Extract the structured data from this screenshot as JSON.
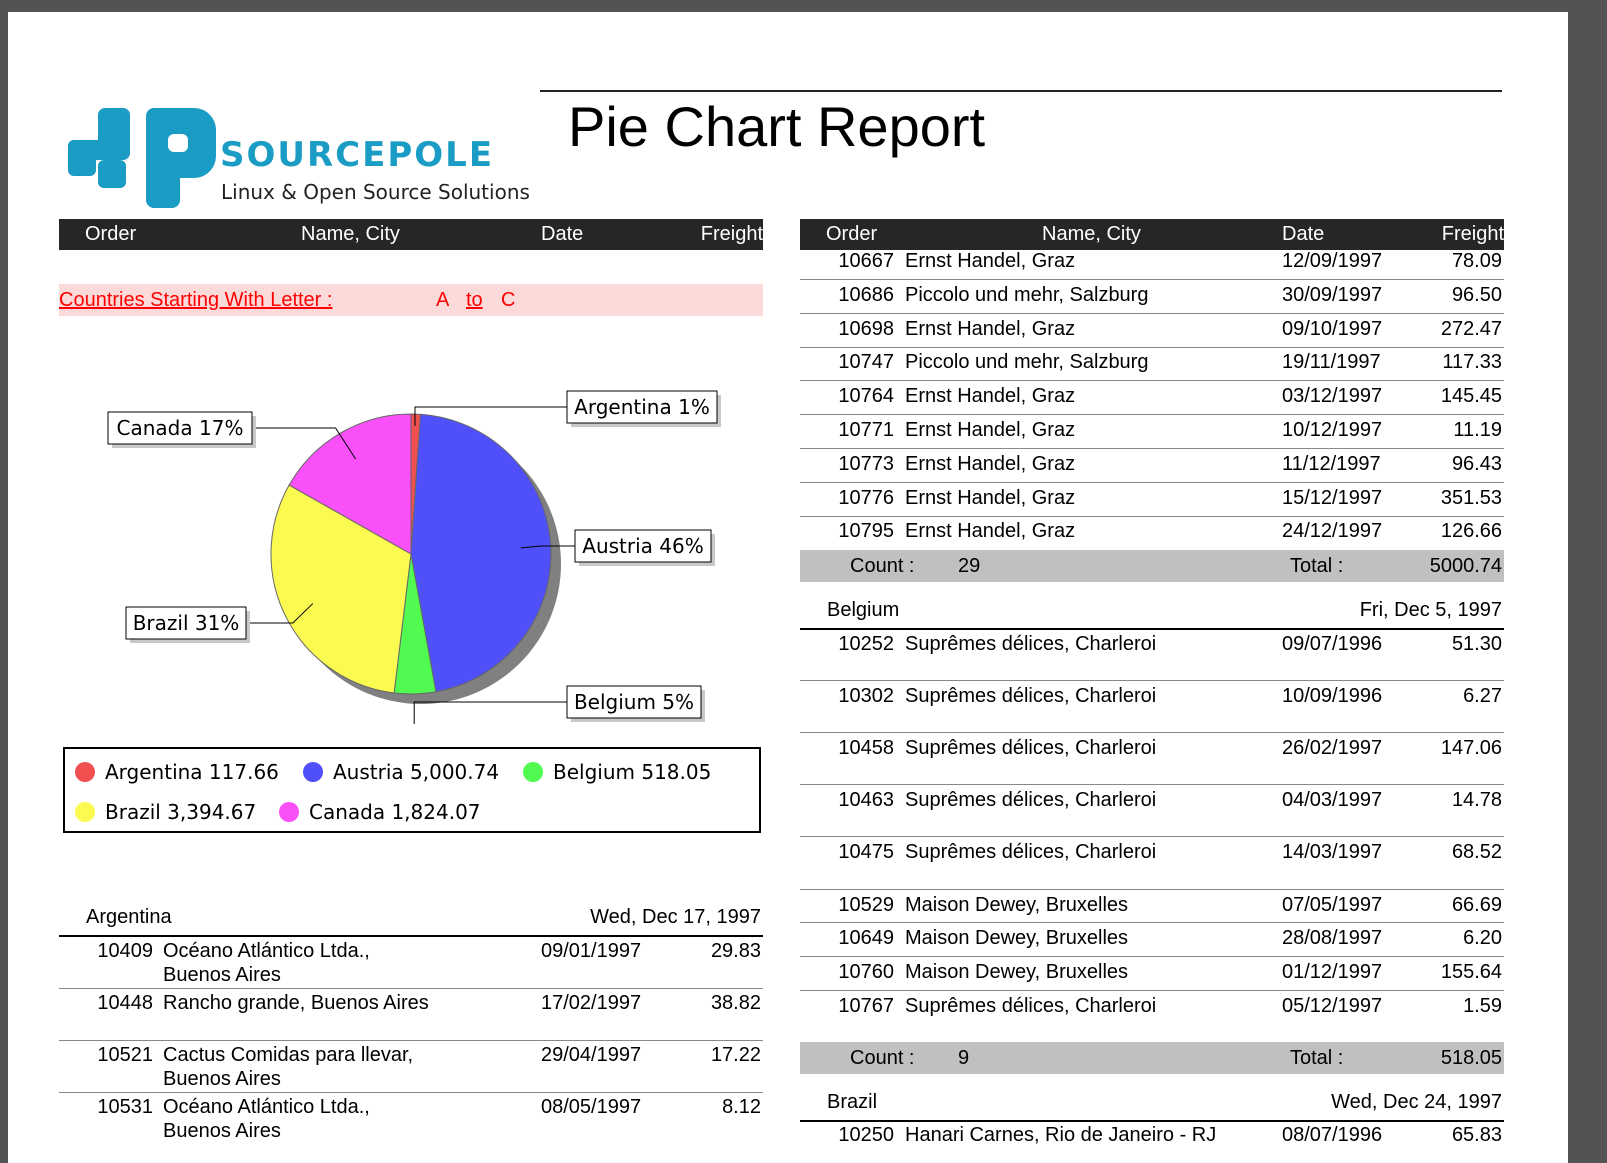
{
  "title": "Pie Chart Report",
  "logo": {
    "word": "SOURCEPOLE",
    "tagline": "Linux & Open Source Solutions"
  },
  "columns": {
    "order": "Order",
    "name_city": "Name, City",
    "date": "Date",
    "freight": "Freight"
  },
  "banner": {
    "label": "Countries Starting With Letter :",
    "from": "A",
    "to_word": "to",
    "to": "C"
  },
  "chart_data": {
    "type": "pie",
    "categories": [
      "Argentina",
      "Austria",
      "Belgium",
      "Brazil",
      "Canada"
    ],
    "values": [
      117.66,
      5000.74,
      518.05,
      3394.67,
      1824.07
    ],
    "percent_labels": [
      "Argentina 1%",
      "Austria 46%",
      "Belgium 5%",
      "Brazil 31%",
      "Canada 17%"
    ],
    "legend_labels": [
      "Argentina 117.66",
      "Austria 5,000.74",
      "Belgium 518.05",
      "Brazil 3,394.67",
      "Canada 1,824.07"
    ],
    "colors": [
      "#f05050",
      "#5050fa",
      "#50fa50",
      "#fafa50",
      "#fa50fa"
    ],
    "legend": "bottom"
  },
  "argentina": {
    "country": "Argentina",
    "date": "Wed, Dec 17, 1997",
    "rows": [
      {
        "order": "10409",
        "name": "Océano Atlántico Ltda.,",
        "name2": "Buenos Aires",
        "date": "09/01/1997",
        "freight": "29.83"
      },
      {
        "order": "10448",
        "name": "Rancho grande, Buenos Aires",
        "name2": "",
        "date": "17/02/1997",
        "freight": "38.82"
      },
      {
        "order": "10521",
        "name": "Cactus Comidas para llevar,",
        "name2": "Buenos Aires",
        "date": "29/04/1997",
        "freight": "17.22"
      },
      {
        "order": "10531",
        "name": "Océano Atlántico Ltda.,",
        "name2": "Buenos Aires",
        "date": "08/05/1997",
        "freight": "8.12"
      }
    ]
  },
  "austria": {
    "rows": [
      {
        "order": "10667",
        "name": "Ernst Handel, Graz",
        "date": "12/09/1997",
        "freight": "78.09"
      },
      {
        "order": "10686",
        "name": "Piccolo und mehr, Salzburg",
        "date": "30/09/1997",
        "freight": "96.50"
      },
      {
        "order": "10698",
        "name": "Ernst Handel, Graz",
        "date": "09/10/1997",
        "freight": "272.47"
      },
      {
        "order": "10747",
        "name": "Piccolo und mehr, Salzburg",
        "date": "19/11/1997",
        "freight": "117.33"
      },
      {
        "order": "10764",
        "name": "Ernst Handel, Graz",
        "date": "03/12/1997",
        "freight": "145.45"
      },
      {
        "order": "10771",
        "name": "Ernst Handel, Graz",
        "date": "10/12/1997",
        "freight": "11.19"
      },
      {
        "order": "10773",
        "name": "Ernst Handel, Graz",
        "date": "11/12/1997",
        "freight": "96.43"
      },
      {
        "order": "10776",
        "name": "Ernst Handel, Graz",
        "date": "15/12/1997",
        "freight": "351.53"
      },
      {
        "order": "10795",
        "name": "Ernst Handel, Graz",
        "date": "24/12/1997",
        "freight": "126.66"
      }
    ],
    "count_label": "Count :",
    "count": "29",
    "total_label": "Total :",
    "total": "5000.74"
  },
  "belgium": {
    "country": "Belgium",
    "date": "Fri, Dec 5, 1997",
    "rows": [
      {
        "order": "10252",
        "name": "Suprêmes délices, Charleroi",
        "date": "09/07/1996",
        "freight": "51.30"
      },
      {
        "order": "10302",
        "name": "Suprêmes délices, Charleroi",
        "date": "10/09/1996",
        "freight": "6.27"
      },
      {
        "order": "10458",
        "name": "Suprêmes délices, Charleroi",
        "date": "26/02/1997",
        "freight": "147.06"
      },
      {
        "order": "10463",
        "name": "Suprêmes délices, Charleroi",
        "date": "04/03/1997",
        "freight": "14.78"
      },
      {
        "order": "10475",
        "name": "Suprêmes délices, Charleroi",
        "date": "14/03/1997",
        "freight": "68.52"
      },
      {
        "order": "10529",
        "name": "Maison Dewey, Bruxelles",
        "date": "07/05/1997",
        "freight": "66.69"
      },
      {
        "order": "10649",
        "name": "Maison Dewey, Bruxelles",
        "date": "28/08/1997",
        "freight": "6.20"
      },
      {
        "order": "10760",
        "name": "Maison Dewey, Bruxelles",
        "date": "01/12/1997",
        "freight": "155.64"
      },
      {
        "order": "10767",
        "name": "Suprêmes délices, Charleroi",
        "date": "05/12/1997",
        "freight": "1.59"
      }
    ],
    "count_label": "Count :",
    "count": "9",
    "total_label": "Total :",
    "total": "518.05"
  },
  "brazil": {
    "country": "Brazil",
    "date": "Wed, Dec 24, 1997",
    "first_row": {
      "order": "10250",
      "name": "Hanari Carnes, Rio de Janeiro - RJ",
      "date": "08/07/1996",
      "freight": "65.83"
    }
  }
}
